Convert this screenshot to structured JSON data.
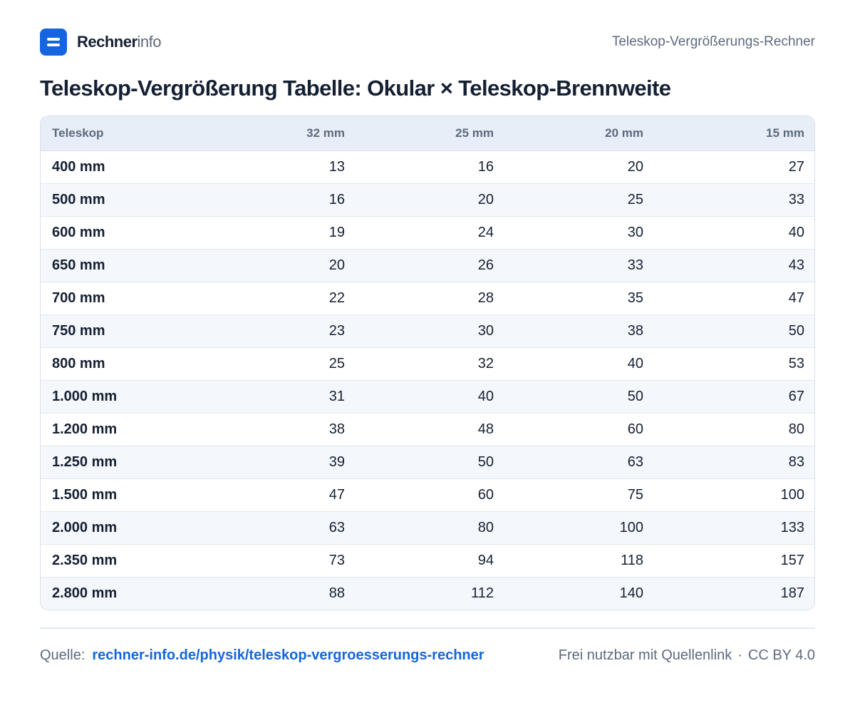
{
  "header": {
    "brand_bold": "Rechner",
    "brand_light": "info",
    "right_title": "Teleskop-Vergrößerungs-Rechner"
  },
  "title": "Teleskop-Vergrößerung Tabelle: Okular × Teleskop-Brennweite",
  "table": {
    "headers": [
      "Teleskop",
      "32 mm",
      "25 mm",
      "20 mm",
      "15 mm"
    ],
    "rows": [
      [
        "400 mm",
        "13",
        "16",
        "20",
        "27"
      ],
      [
        "500 mm",
        "16",
        "20",
        "25",
        "33"
      ],
      [
        "600 mm",
        "19",
        "24",
        "30",
        "40"
      ],
      [
        "650 mm",
        "20",
        "26",
        "33",
        "43"
      ],
      [
        "700 mm",
        "22",
        "28",
        "35",
        "47"
      ],
      [
        "750 mm",
        "23",
        "30",
        "38",
        "50"
      ],
      [
        "800 mm",
        "25",
        "32",
        "40",
        "53"
      ],
      [
        "1.000 mm",
        "31",
        "40",
        "50",
        "67"
      ],
      [
        "1.200 mm",
        "38",
        "48",
        "60",
        "80"
      ],
      [
        "1.250 mm",
        "39",
        "50",
        "63",
        "83"
      ],
      [
        "1.500 mm",
        "47",
        "60",
        "75",
        "100"
      ],
      [
        "2.000 mm",
        "63",
        "80",
        "100",
        "133"
      ],
      [
        "2.350 mm",
        "73",
        "94",
        "118",
        "157"
      ],
      [
        "2.800 mm",
        "88",
        "112",
        "140",
        "187"
      ]
    ]
  },
  "footer": {
    "source_label": "Quelle:",
    "source_link": "rechner-info.de/physik/teleskop-vergroesserungs-rechner",
    "license_text": "Frei nutzbar mit Quellenlink",
    "separator": "·",
    "license": "CC BY 4.0"
  },
  "colors": {
    "accent": "#1565e0",
    "text": "#152033",
    "muted": "#5d6a7d",
    "header_bg": "#e7eef7",
    "row_alt_bg": "#f4f7fb"
  },
  "icons": {
    "logo": "menu-lines-icon"
  }
}
